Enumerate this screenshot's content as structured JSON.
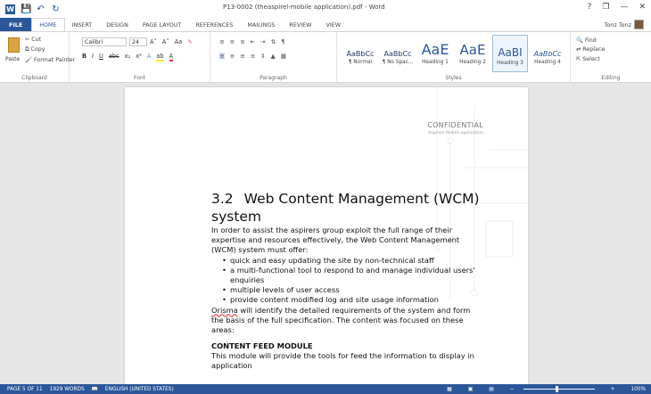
{
  "titlebar": {
    "title": "P13-0002 (theaspirel-mobile application).pdf - Word",
    "help": "?",
    "minimize": "—",
    "restore": "❐",
    "close": "✕"
  },
  "tabs": [
    "FILE",
    "HOME",
    "INSERT",
    "DESIGN",
    "PAGE LAYOUT",
    "REFERENCES",
    "MAILINGS",
    "REVIEW",
    "VIEW"
  ],
  "active_tab": "HOME",
  "user": {
    "name": "Tonz Tonz"
  },
  "clipboard": {
    "paste": "Paste",
    "cut": "Cut",
    "copy": "Copy",
    "format_painter": "Format Painter",
    "label": "Clipboard"
  },
  "font": {
    "name": "Calibri",
    "size": "24",
    "label": "Font",
    "bold": "B",
    "italic": "I",
    "underline": "U",
    "grow": "A˄",
    "shrink": "A˅",
    "case": "Aa",
    "strike": "abc",
    "sub": "x₂",
    "sup": "x²"
  },
  "paragraph": {
    "label": "Paragraph"
  },
  "styles": {
    "label": "Styles",
    "items": [
      {
        "sample": "AaBbCc",
        "name": "¶ Normal"
      },
      {
        "sample": "AaBbCc",
        "name": "¶ No Spac..."
      },
      {
        "sample": "AaE",
        "name": "Heading 1"
      },
      {
        "sample": "AaE",
        "name": "Heading 2"
      },
      {
        "sample": "AaBI",
        "name": "Heading 3"
      },
      {
        "sample": "AaBbCc",
        "name": "Heading 4"
      }
    ]
  },
  "editing": {
    "find": "Find",
    "replace": "Replace",
    "select": "Select",
    "label": "Editing"
  },
  "document": {
    "header_confidential": "CONFIDENTIAL",
    "header_sub": "Aspirers Mobile application",
    "heading_num": "3.2",
    "heading_text": "Web Content Management (WCM)",
    "heading_cont": "system",
    "intro": "In order to assist the aspirers group exploit the full range of their expertise and resources effectively, the Web Content Management (WCM) system must offer:",
    "bullets": [
      "quick and easy updating the site by non-technical staff",
      "a multi-functional tool to respond to and manage individual users' enquiries",
      "multiple levels of user access",
      "provide content modified log and site usage information"
    ],
    "para2_spell": "Orisma",
    "para2_rest": " will identify the detailed requirements of the system and form the basis of the full specification. The content was focused on these areas:",
    "subheading": "CONTENT FEED MODULE",
    "para3": "This module will provide the tools for feed the information to display in application"
  },
  "status": {
    "page": "PAGE 5 OF 11",
    "words": "1929 WORDS",
    "language": "ENGLISH (UNITED STATES)",
    "zoom": "100%"
  }
}
